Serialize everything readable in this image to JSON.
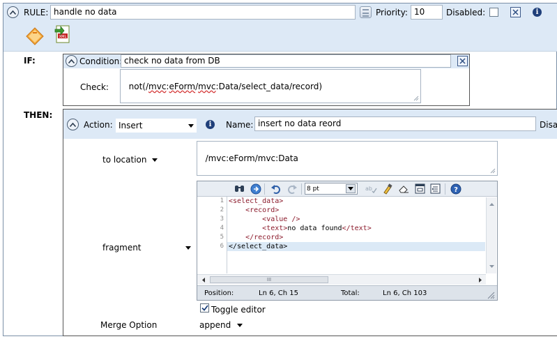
{
  "rule": {
    "label": "RULE:",
    "name": "handle no data",
    "priority_label": "Priority:",
    "priority": "10",
    "disabled_label": "Disabled:"
  },
  "if_section": {
    "label": "IF:",
    "condition_label": "Condition:",
    "condition_name": "check no data from DB",
    "check_label": "Check:",
    "check_expr_parts": [
      "not(/",
      "mvc",
      ":",
      "eForm",
      "/",
      "mvc",
      ":Data/select_data/record)"
    ]
  },
  "then_section": {
    "label": "THEN:",
    "action_label": "Action:",
    "action_value": "Insert",
    "name_label": "Name:",
    "name_value": "insert no data reord",
    "disabled_label_cut": "Disa"
  },
  "location": {
    "select_value": "to location",
    "path": "/mvc:eForm/mvc:Data"
  },
  "fragment": {
    "select_value": "fragment",
    "font_size": "8 pt",
    "line_numbers": [
      "1",
      "2",
      "3",
      "4",
      "5",
      "6"
    ],
    "code": [
      {
        "indent": "",
        "open": "<select_data>",
        "text": "",
        "close": ""
      },
      {
        "indent": "    ",
        "open": "<record>",
        "text": "",
        "close": ""
      },
      {
        "indent": "        ",
        "open": "<value />",
        "text": "",
        "close": ""
      },
      {
        "indent": "        ",
        "open": "<text>",
        "text": "no data found",
        "close": "</text>"
      },
      {
        "indent": "    ",
        "open": "</record>",
        "text": "",
        "close": ""
      },
      {
        "indent": "",
        "open": "</select_data>",
        "text": "",
        "close": ""
      }
    ],
    "scroll_mark": "III",
    "status": {
      "position_label": "Position:",
      "position_value": "Ln 6, Ch 15",
      "total_label": "Total:",
      "total_value": "Ln 6, Ch 103"
    },
    "toggle_label": "Toggle editor"
  },
  "merge": {
    "label": "Merge Option",
    "value": "append"
  },
  "colors": {
    "header_bg": "#dde9f6",
    "tag_color": "#8b1a2b",
    "active_line": "#dbe9f6"
  }
}
